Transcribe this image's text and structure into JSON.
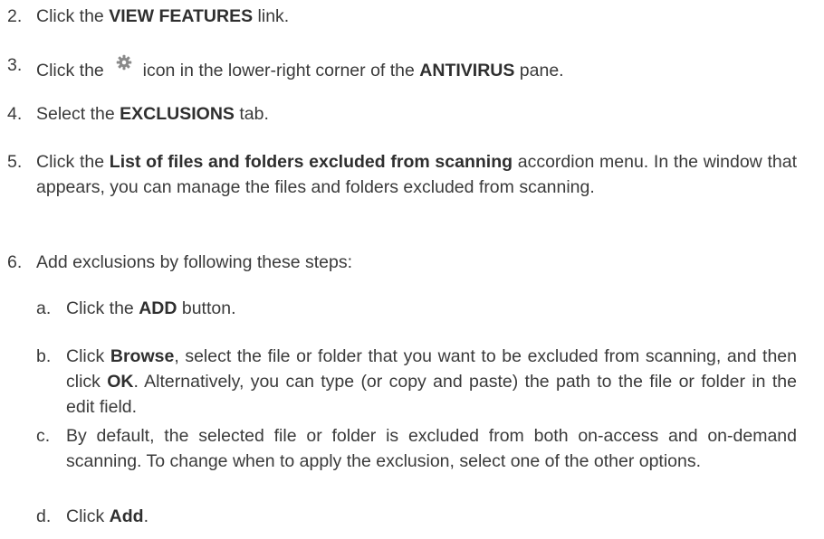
{
  "steps": [
    {
      "num": "2.",
      "pre": "Click the ",
      "b1": "VIEW FEATURES",
      "post": " link."
    },
    {
      "num": "3.",
      "pre": "Click the ",
      "icon": "gear-icon",
      "mid": " icon in the lower-right corner of the ",
      "b1": "ANTIVIRUS",
      "post": " pane."
    },
    {
      "num": "4.",
      "pre": "Select the ",
      "b1": "EXCLUSIONS",
      "post": " tab."
    },
    {
      "num": "5.",
      "pre": "Click the ",
      "b1": "List of files and folders excluded from scanning",
      "post": " accordion menu. In the window that appears, you can manage the files and folders excluded from scanning."
    },
    {
      "num": "6.",
      "text": "Add exclusions by following these steps:"
    }
  ],
  "substeps": [
    {
      "num": "a.",
      "pre": "Click the ",
      "b1": "ADD",
      "post": " button."
    },
    {
      "num": "b.",
      "pre": "Click ",
      "b1": "Browse",
      "mid": ", select the file or folder that you want to be excluded from scanning, and then click ",
      "b2": "OK",
      "post": ". Alternatively, you can type (or copy and paste) the path to the file or folder in the edit field."
    },
    {
      "num": "c.",
      "text": "By default, the selected file or folder is excluded from both on-access and on-demand scanning. To change when to apply the exclusion, select one of the other options."
    },
    {
      "num": "d.",
      "pre": "Click ",
      "b1": "Add",
      "post": "."
    }
  ],
  "colors": {
    "text": "#3a3a3a",
    "icon": "#8a8a8a"
  }
}
